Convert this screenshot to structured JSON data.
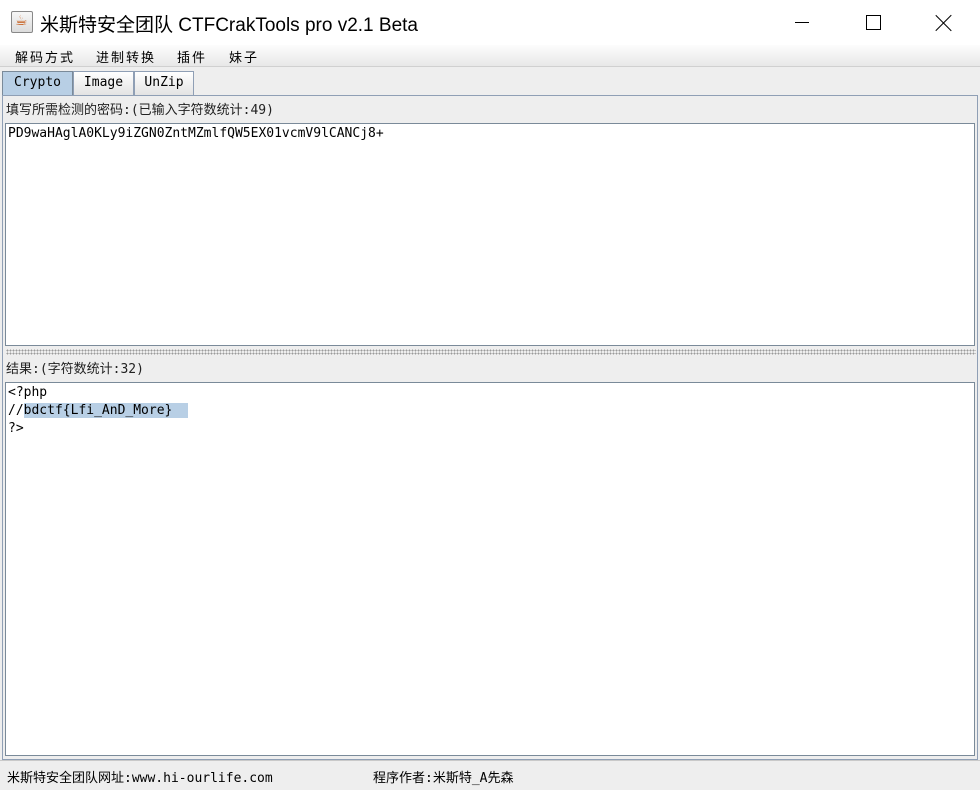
{
  "window": {
    "title": "米斯特安全团队 CTFCrakTools pro v2.1 Beta"
  },
  "menu": {
    "items": [
      "解码方式",
      "进制转换",
      "插件",
      "妹子"
    ]
  },
  "tabs": [
    {
      "label": "Crypto",
      "active": true
    },
    {
      "label": "Image",
      "active": false
    },
    {
      "label": "UnZip",
      "active": false
    }
  ],
  "input": {
    "label": "填写所需检测的密码:(已输入字符数统计:49)",
    "value": "PD9waHAglA0KLy9iZGN0ZntMZmlfQW5EX01vcmV9lCANCj8+"
  },
  "result": {
    "label": "结果:(字符数统计:32)",
    "lines": [
      "<?php",
      "//",
      "bdctf{Lfi_AnD_More}",
      "?>"
    ]
  },
  "status": {
    "site": "米斯特安全团队网址:www.hi-ourlife.com",
    "author": "程序作者:米斯特_A先森"
  },
  "colors": {
    "selection": "#b8cfe5",
    "active_tab": "#b8cfe5"
  }
}
